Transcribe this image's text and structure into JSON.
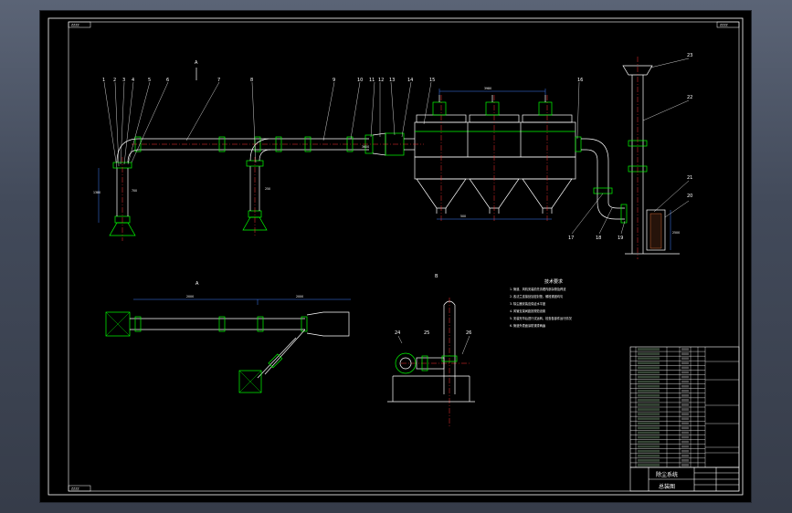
{
  "drawing": {
    "title_cn": "除尘系统",
    "subtitle_cn": "总装图",
    "tech_title_cn": "技术要求",
    "view_a": "A",
    "view_b": "B",
    "corner_tl": "ZZZZ",
    "corner_tr": "ZZZZ",
    "corner_bl": "ZZZZ",
    "notes": [
      "1. 管道、风机安装前先清理内部杂物及焊渣",
      "2. 各法兰连接处加密封垫，螺栓紧固均匀",
      "3. 除尘器安装应保证水平度",
      "4. 风管支架间距按规范设置",
      "5. 安装完毕后进行试运转，检查各部件运行情况",
      "6. 管道外表面涂防锈漆两遍"
    ],
    "balloons": [
      "1",
      "2",
      "3",
      "4",
      "5",
      "6",
      "7",
      "8",
      "9",
      "10",
      "11",
      "12",
      "13",
      "14",
      "15",
      "16",
      "17",
      "18",
      "19",
      "20",
      "21",
      "22",
      "23",
      "24",
      "25",
      "26"
    ],
    "dims": [
      "3980",
      "2000",
      "2000",
      "500",
      "1380",
      "2500",
      "3600",
      "700",
      "250"
    ]
  }
}
